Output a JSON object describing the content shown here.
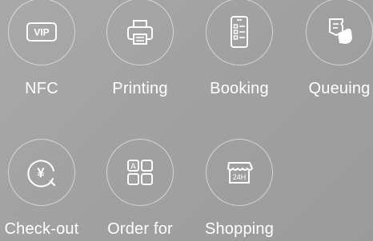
{
  "colors": {
    "background": "#a3a3a3",
    "foreground": "#ffffff"
  },
  "tiles": [
    {
      "label": "NFC",
      "icon": "vip-card-icon"
    },
    {
      "label": "Printing",
      "icon": "printer-icon"
    },
    {
      "label": "Booking",
      "icon": "phone-checklist-icon"
    },
    {
      "label": "Queuing",
      "icon": "ticket-hand-icon"
    },
    {
      "label": "Check-out",
      "icon": "yen-coin-icon"
    },
    {
      "label": "Order for",
      "icon": "menu-grid-icon"
    },
    {
      "label": "Shopping",
      "icon": "store-24h-icon"
    }
  ],
  "icon_text": {
    "vip": "VIP",
    "grid_letter": "A",
    "store_hours": "24H",
    "yen": "¥"
  }
}
